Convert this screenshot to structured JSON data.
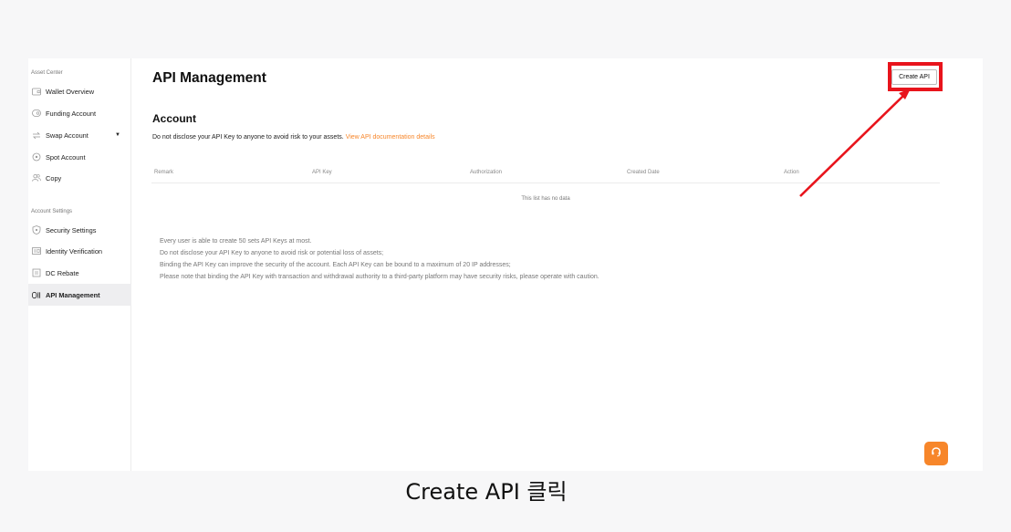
{
  "sidebar": {
    "asset_section": "Asset Center",
    "settings_section": "Account Settings",
    "items": [
      {
        "label": "Wallet Overview",
        "icon": "wallet-icon"
      },
      {
        "label": "Funding Account",
        "icon": "funding-icon"
      },
      {
        "label": "Swap Account",
        "icon": "swap-icon"
      },
      {
        "label": "Spot Account",
        "icon": "spot-icon"
      },
      {
        "label": "Copy",
        "icon": "copy-users-icon"
      },
      {
        "label": "Security Settings",
        "icon": "shield-icon"
      },
      {
        "label": "Identity Verification",
        "icon": "id-card-icon"
      },
      {
        "label": "DC Rebate",
        "icon": "rebate-icon"
      },
      {
        "label": "API Management",
        "icon": "api-icon"
      }
    ],
    "active": "API Management",
    "swap_caret": "▼"
  },
  "header": {
    "title": "API Management",
    "create_button": "Create API"
  },
  "account": {
    "title": "Account",
    "notice": "Do not disclose your API Key to anyone to avoid risk to your assets.",
    "link": "View API documentation details"
  },
  "table": {
    "columns": [
      "Remark",
      "API Key",
      "Authorization",
      "Created Date",
      "Action"
    ],
    "empty": "This list has no data"
  },
  "notes": [
    "Every user is able to create 50 sets API Keys at most.",
    "Do not disclose your API Key to anyone to avoid risk or potential loss of assets;",
    "Binding the API Key can improve the security of the account. Each API Key can be bound to a maximum of 20 IP addresses;",
    "Please note that binding the API Key with transaction and withdrawal authority to a third-party platform may have security risks, please operate with caution."
  ],
  "caption": "Create API 클릭",
  "colors": {
    "accent": "#f7862a",
    "highlight": "#e8141c",
    "active_bg": "#eeeef0"
  }
}
